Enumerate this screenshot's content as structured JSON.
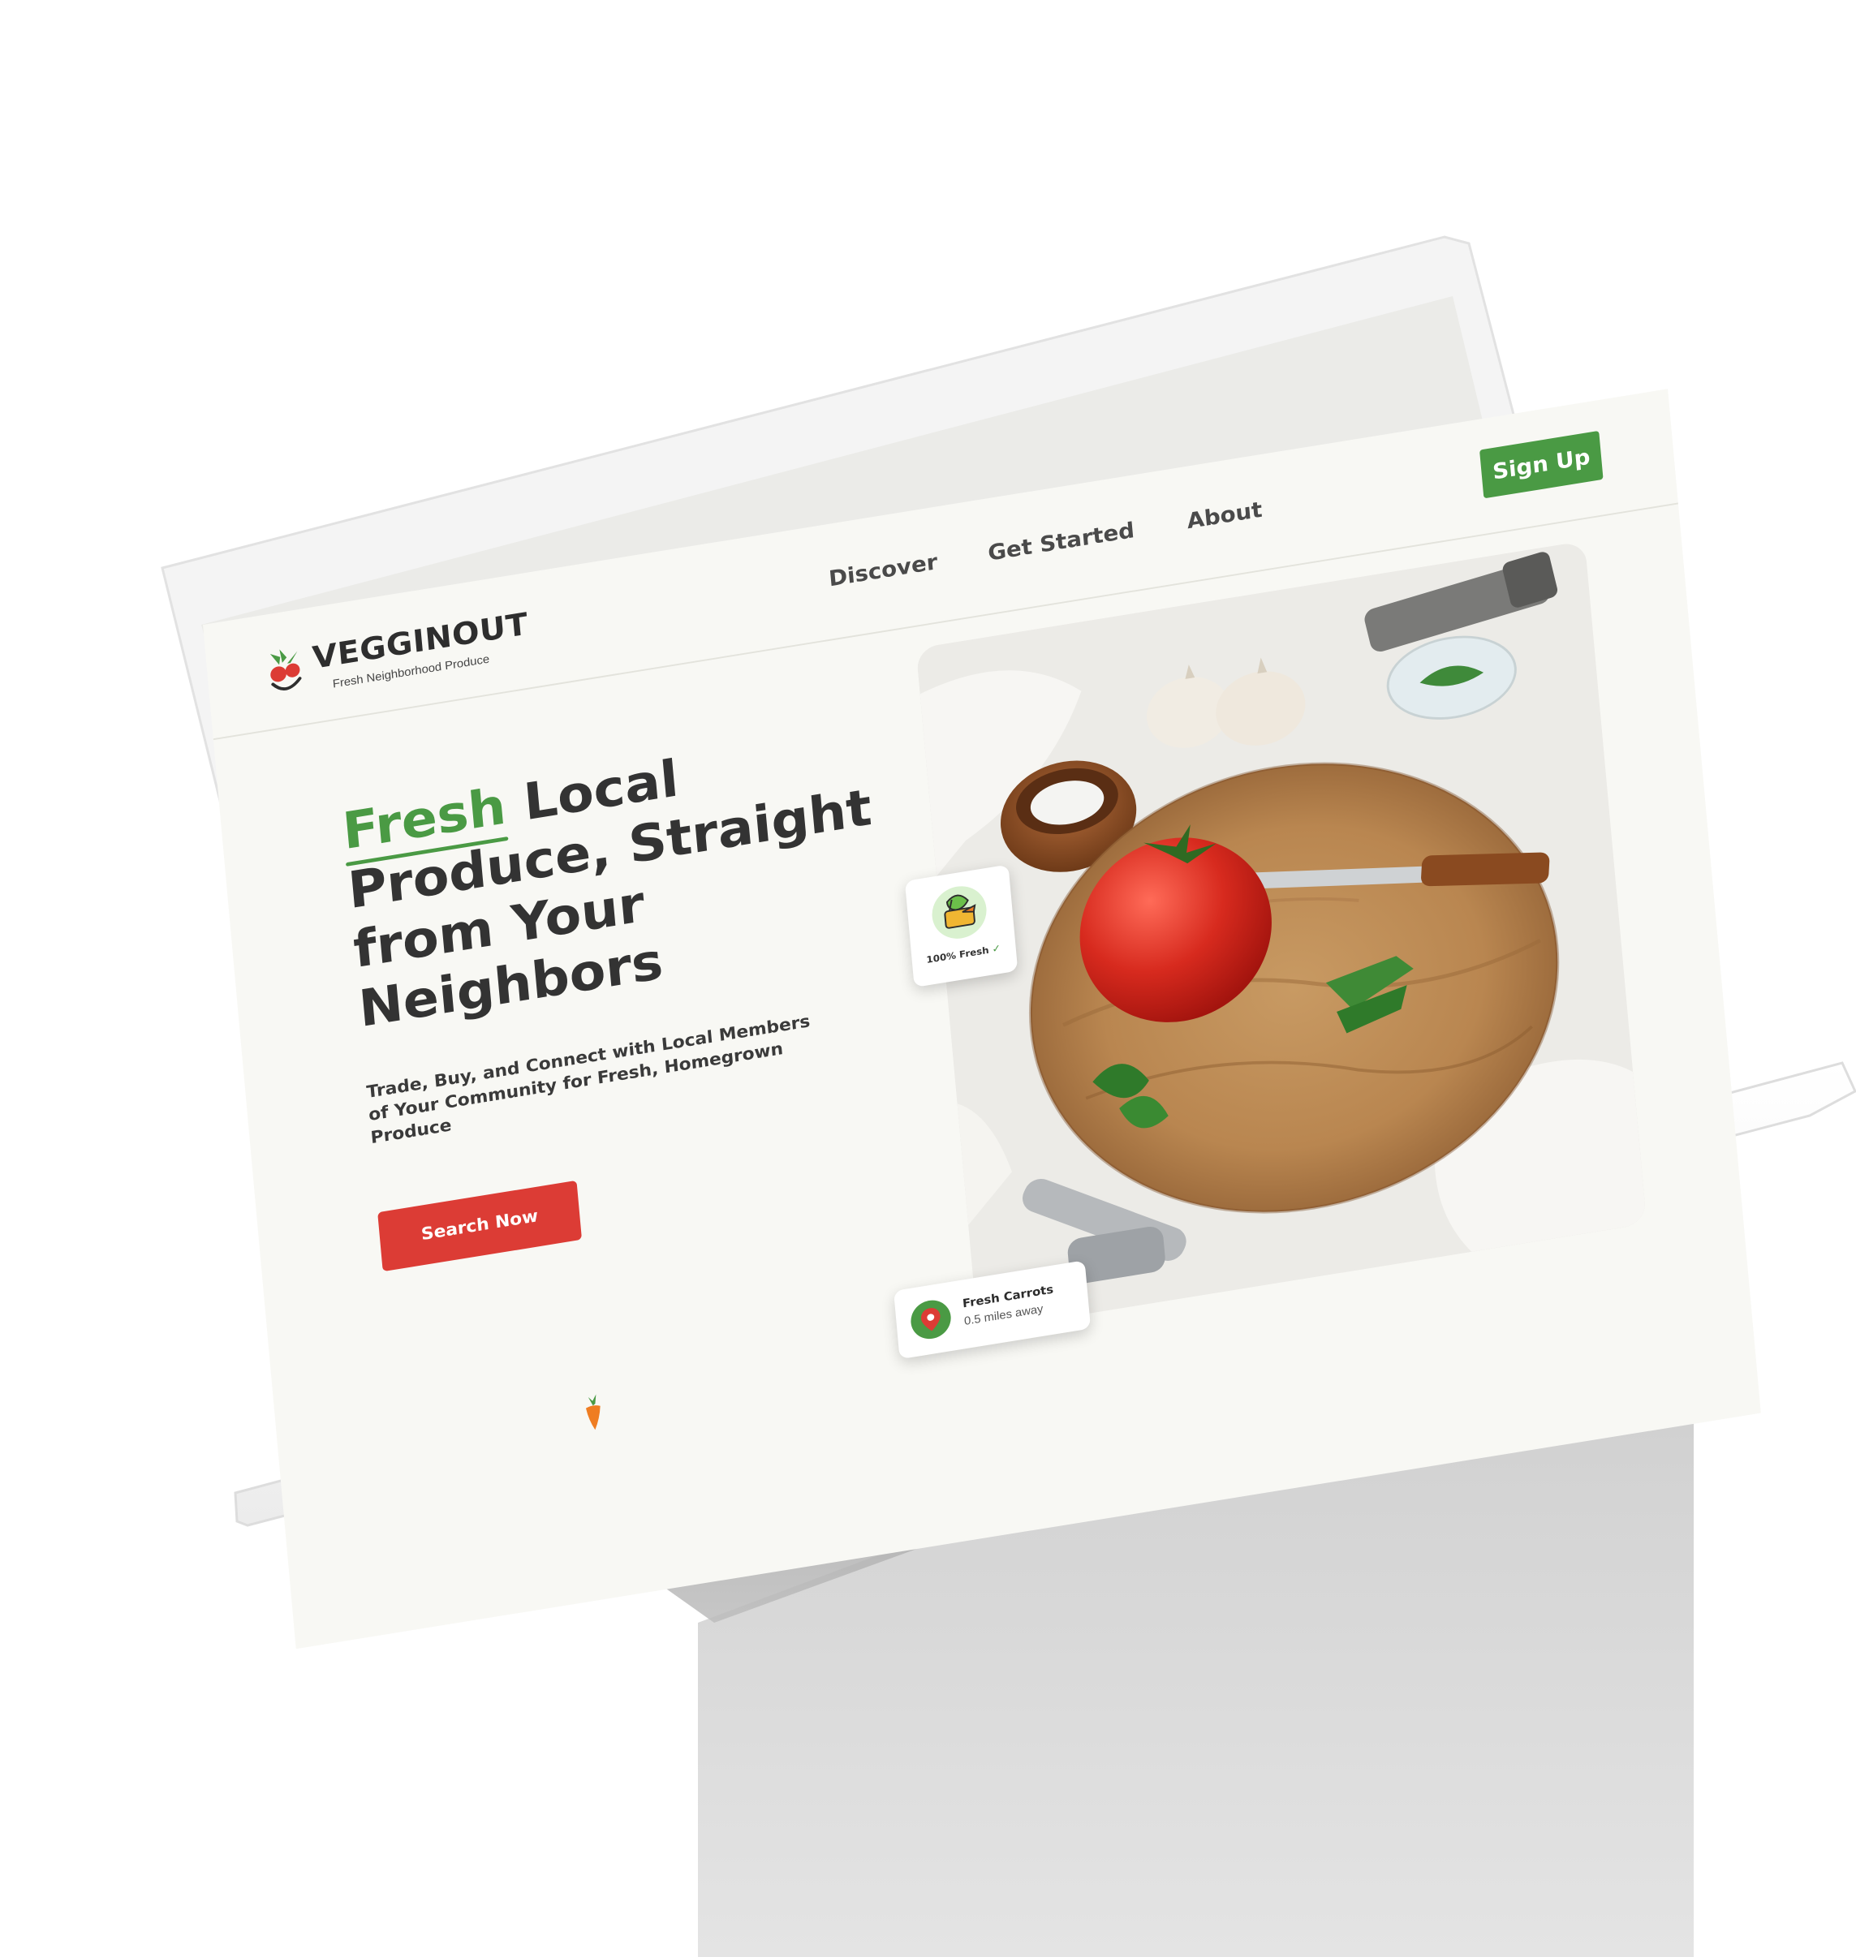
{
  "brand": {
    "name": "VEGGINOUT",
    "tagline": "Fresh Neighborhood Produce"
  },
  "nav": {
    "links": [
      "Discover",
      "Get Started",
      "About"
    ],
    "signup_label": "Sign Up"
  },
  "hero": {
    "headline_highlight": "Fresh",
    "headline_rest": "Local Produce, Straight from Your Neighbors",
    "subtext": "Trade, Buy, and Connect with Local Members of Your Community for Fresh, Homegrown Produce",
    "cta_label": "Search Now"
  },
  "cards": {
    "fresh_badge": "100% Fresh",
    "location_title": "Fresh Carrots",
    "location_distance": "0.5 miles away"
  },
  "colors": {
    "brand_green": "#4a9a44",
    "cta_red": "#dc3c35",
    "page_bg": "#f8f8f4",
    "text_dark": "#333333"
  },
  "icons": {
    "logo": "radish-logo-icon",
    "fresh_badge": "vegetable-basket-icon",
    "check": "check-icon",
    "location": "map-pin-icon",
    "decoration": "carrot-icon"
  }
}
